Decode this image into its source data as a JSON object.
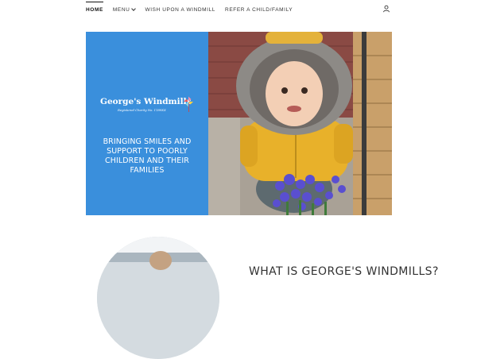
{
  "nav": {
    "items": [
      {
        "label": "Home"
      },
      {
        "label": "Menu"
      },
      {
        "label": "Wish upon a windmill"
      },
      {
        "label": "Refer a child/family"
      }
    ]
  },
  "hero": {
    "logo_title": "George's Windmills",
    "logo_subtitle": "Registered Charity No. 1189XX",
    "tagline": "Bringing smiles and support to poorly children and their families"
  },
  "about": {
    "title": "What is George's Windmills?"
  },
  "icons": {
    "account": "user-icon",
    "dropdown": "chevron-down-icon",
    "logo": "windmill-icon"
  },
  "colors": {
    "hero_panel": "#3a8fdc",
    "jacket": "#e8b12a",
    "flowers": "#5a4fd0"
  }
}
